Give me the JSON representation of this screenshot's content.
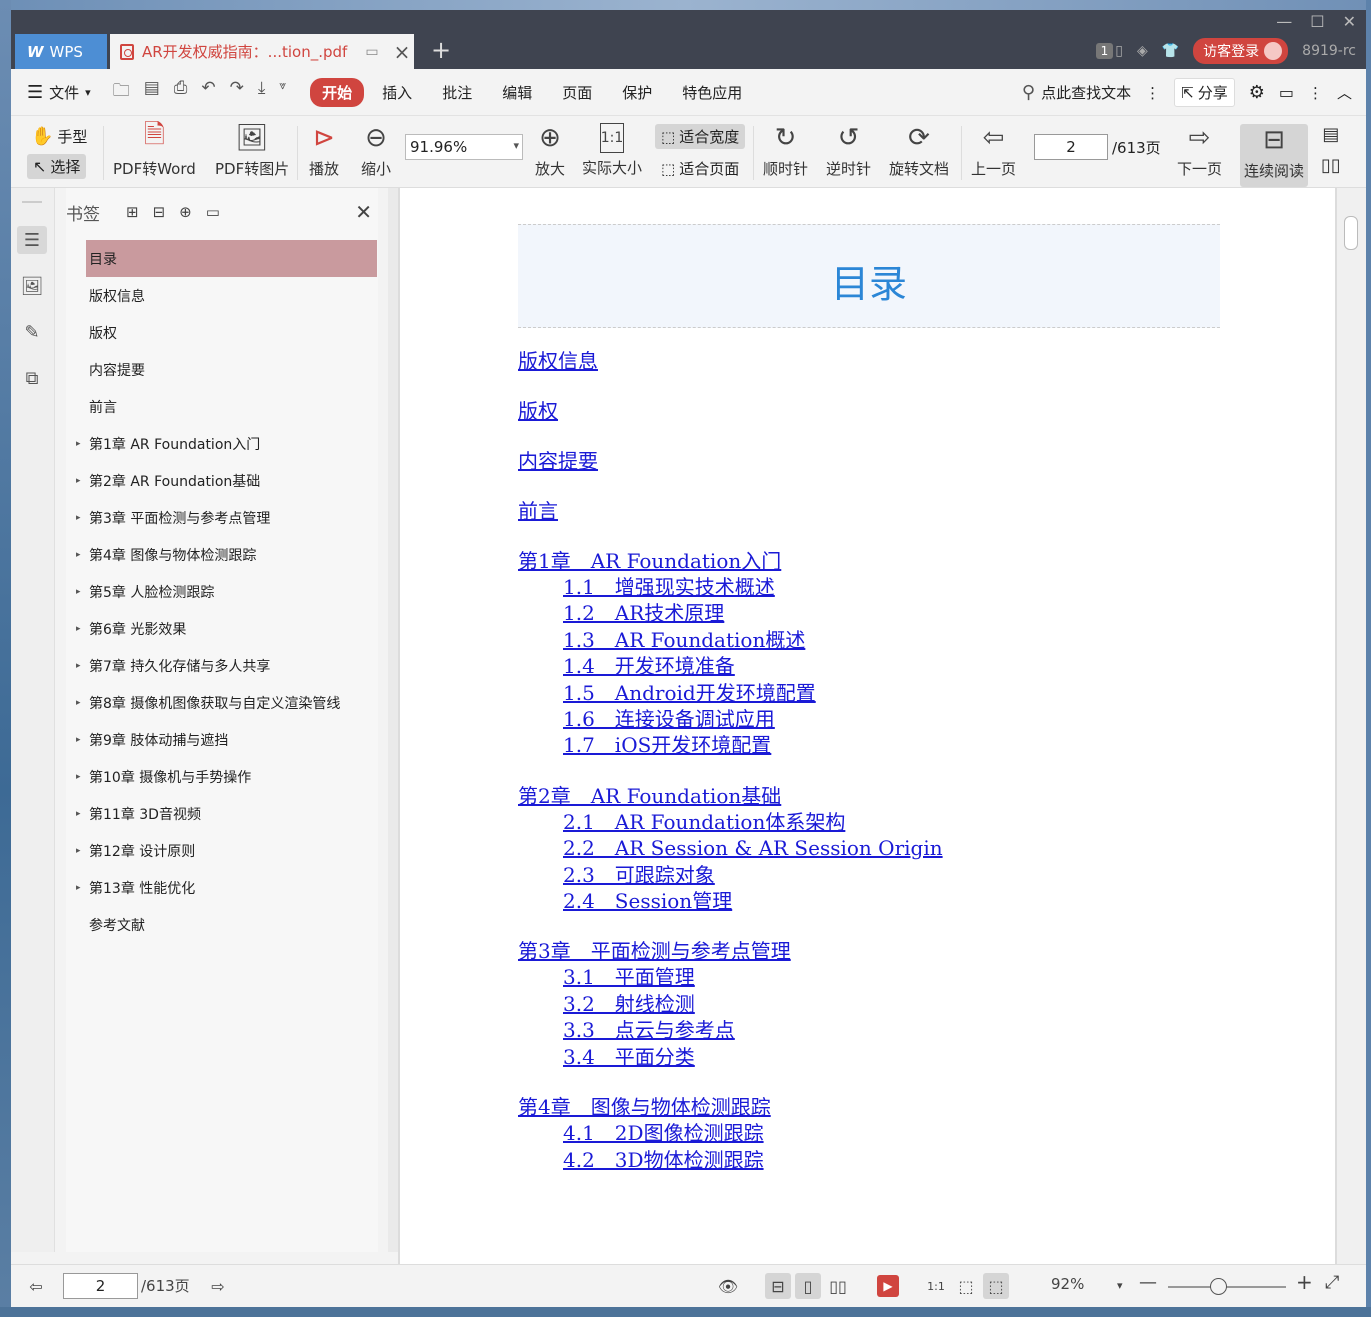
{
  "app": {
    "brand": "WPS",
    "doc_tab_title": "AR开发权威指南：...tion_.pdf",
    "tab_count": "1",
    "login_label": "访客登录",
    "user_id": "8919-rc"
  },
  "menu": {
    "file_label": "文件",
    "tabs": [
      "开始",
      "插入",
      "批注",
      "编辑",
      "页面",
      "保护",
      "特色应用"
    ],
    "search_text": "点此查找文本",
    "share_label": "分享"
  },
  "toolbar": {
    "hand": "手型",
    "select": "选择",
    "pdf_to_word": "PDF转Word",
    "pdf_to_image": "PDF转图片",
    "play": "播放",
    "zoom_out": "缩小",
    "zoom_value": "91.96%",
    "zoom_in": "放大",
    "actual_size": "实际大小",
    "fit_width": "适合宽度",
    "fit_page": "适合页面",
    "rotate_cw": "顺时针",
    "rotate_ccw": "逆时针",
    "rotate_doc": "旋转文档",
    "prev_page": "上一页",
    "page_input": "2",
    "page_total": "/613页",
    "next_page": "下一页",
    "continuous": "连续阅读"
  },
  "bookmarks": {
    "title": "书签",
    "items": [
      {
        "label": "目录",
        "expandable": false,
        "active": true
      },
      {
        "label": "版权信息",
        "expandable": false
      },
      {
        "label": "版权",
        "expandable": false
      },
      {
        "label": "内容提要",
        "expandable": false
      },
      {
        "label": "前言",
        "expandable": false
      },
      {
        "label": "第1章 AR Foundation入门",
        "expandable": true
      },
      {
        "label": "第2章 AR Foundation基础",
        "expandable": true
      },
      {
        "label": "第3章 平面检测与参考点管理",
        "expandable": true
      },
      {
        "label": "第4章 图像与物体检测跟踪",
        "expandable": true
      },
      {
        "label": "第5章 人脸检测跟踪",
        "expandable": true
      },
      {
        "label": "第6章 光影效果",
        "expandable": true
      },
      {
        "label": "第7章 持久化存储与多人共享",
        "expandable": true
      },
      {
        "label": "第8章 摄像机图像获取与自定义渲染管线",
        "expandable": true
      },
      {
        "label": "第9章 肢体动捕与遮挡",
        "expandable": true
      },
      {
        "label": "第10章 摄像机与手势操作",
        "expandable": true
      },
      {
        "label": "第11章 3D音视频",
        "expandable": true
      },
      {
        "label": "第12章 设计原则",
        "expandable": true
      },
      {
        "label": "第13章 性能优化",
        "expandable": true
      },
      {
        "label": "参考文献",
        "expandable": false
      }
    ]
  },
  "document": {
    "toc_title": "目录",
    "entries": [
      {
        "title": "版权信息",
        "children": []
      },
      {
        "title": "版权",
        "children": []
      },
      {
        "title": "内容提要",
        "children": []
      },
      {
        "title": "前言",
        "children": []
      },
      {
        "title": "第1章　AR Foundation入门",
        "children": [
          "1.1　增强现实技术概述",
          "1.2　AR技术原理",
          "1.3　AR Foundation概述",
          "1.4　开发环境准备",
          "1.5　Android开发环境配置",
          "1.6　连接设备调试应用",
          "1.7　iOS开发环境配置"
        ]
      },
      {
        "title": "第2章　AR Foundation基础",
        "children": [
          "2.1　AR Foundation体系架构",
          "2.2　AR Session & AR Session Origin",
          "2.3　可跟踪对象",
          "2.4　Session管理"
        ]
      },
      {
        "title": "第3章　平面检测与参考点管理",
        "children": [
          "3.1　平面管理",
          "3.2　射线检测",
          "3.3　点云与参考点",
          "3.4　平面分类"
        ]
      },
      {
        "title": "第4章　图像与物体检测跟踪",
        "children": [
          "4.1　2D图像检测跟踪",
          "4.2　3D物体检测跟踪"
        ]
      }
    ]
  },
  "status": {
    "page_input": "2",
    "page_total": "/613页",
    "zoom_percent": "92%"
  }
}
